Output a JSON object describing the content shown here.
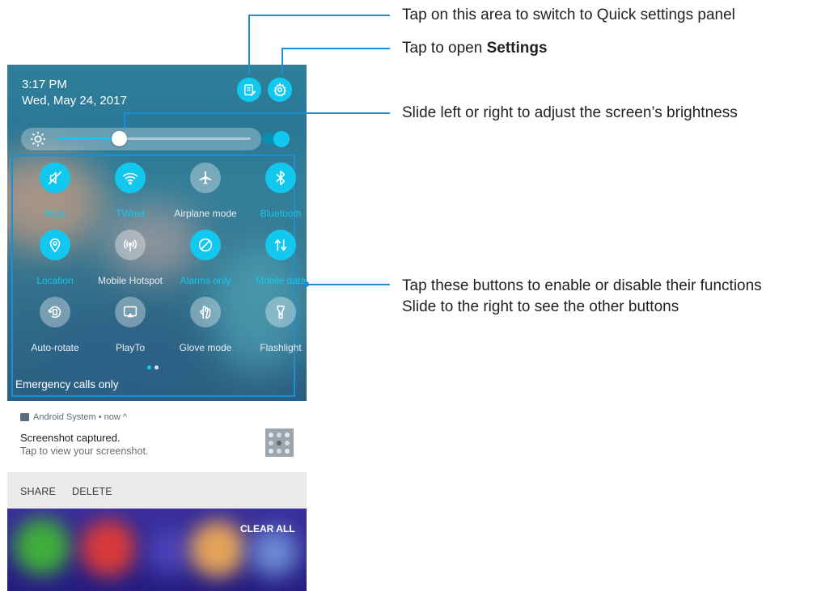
{
  "status": {
    "time": "3:17 PM",
    "date": "Wed, May 24, 2017"
  },
  "header_icons": {
    "edit": "edit-note-icon",
    "settings": "gear-icon"
  },
  "brightness": {
    "level": 0.32,
    "icon": "sun-icon",
    "auto_toggle": "on"
  },
  "quick_settings": {
    "tiles": [
      {
        "name": "mute",
        "label": "Mute",
        "active": true,
        "icon": "mute-icon"
      },
      {
        "name": "wifi",
        "label": "TWnet",
        "active": true,
        "icon": "wifi-icon"
      },
      {
        "name": "airplane",
        "label": "Airplane mode",
        "active": false,
        "icon": "airplane-icon"
      },
      {
        "name": "bluetooth",
        "label": "Bluetooth",
        "active": true,
        "icon": "bluetooth-icon"
      },
      {
        "name": "location",
        "label": "Location",
        "active": true,
        "icon": "location-icon"
      },
      {
        "name": "hotspot",
        "label": "Mobile Hotspot",
        "active": false,
        "icon": "hotspot-icon"
      },
      {
        "name": "alarms",
        "label": "Alarms only",
        "active": true,
        "icon": "do-not-disturb-icon"
      },
      {
        "name": "mobile-data",
        "label": "Mobile data",
        "active": true,
        "icon": "mobile-data-icon"
      },
      {
        "name": "auto-rotate",
        "label": "Auto-rotate",
        "active": false,
        "icon": "rotate-icon"
      },
      {
        "name": "playto",
        "label": "PlayTo",
        "active": false,
        "icon": "cast-icon"
      },
      {
        "name": "glove-mode",
        "label": "Glove mode",
        "active": false,
        "icon": "glove-icon"
      },
      {
        "name": "flashlight",
        "label": "Flashlight",
        "active": false,
        "icon": "flashlight-icon"
      }
    ],
    "page_dots": {
      "count": 2,
      "current": 0
    }
  },
  "emergency_text": "Emergency calls only",
  "notification": {
    "app_line": "Android System • now ^",
    "title": "Screenshot captured.",
    "subtitle": "Tap to view your screenshot.",
    "actions": {
      "share": "SHARE",
      "delete": "DELETE"
    }
  },
  "recents": {
    "clear_all": "CLEAR ALL"
  },
  "annotations": {
    "quick_settings_switch": "Tap on this area to switch to Quick settings panel",
    "settings_prefix": "Tap to open ",
    "settings_bold": "Settings",
    "brightness": "Slide left or right to adjust the screen’s brightness",
    "buttons_line1": "Tap these buttons to enable or disable their functions",
    "buttons_line2": "Slide to the right to see the other buttons"
  },
  "colors": {
    "accent": "#13c8ee",
    "inactive": "rgba(255,255,255,0.35)",
    "callout": "#1a8fd4",
    "active_label": "#13c8ee",
    "inactive_label": "#e8eef2"
  }
}
